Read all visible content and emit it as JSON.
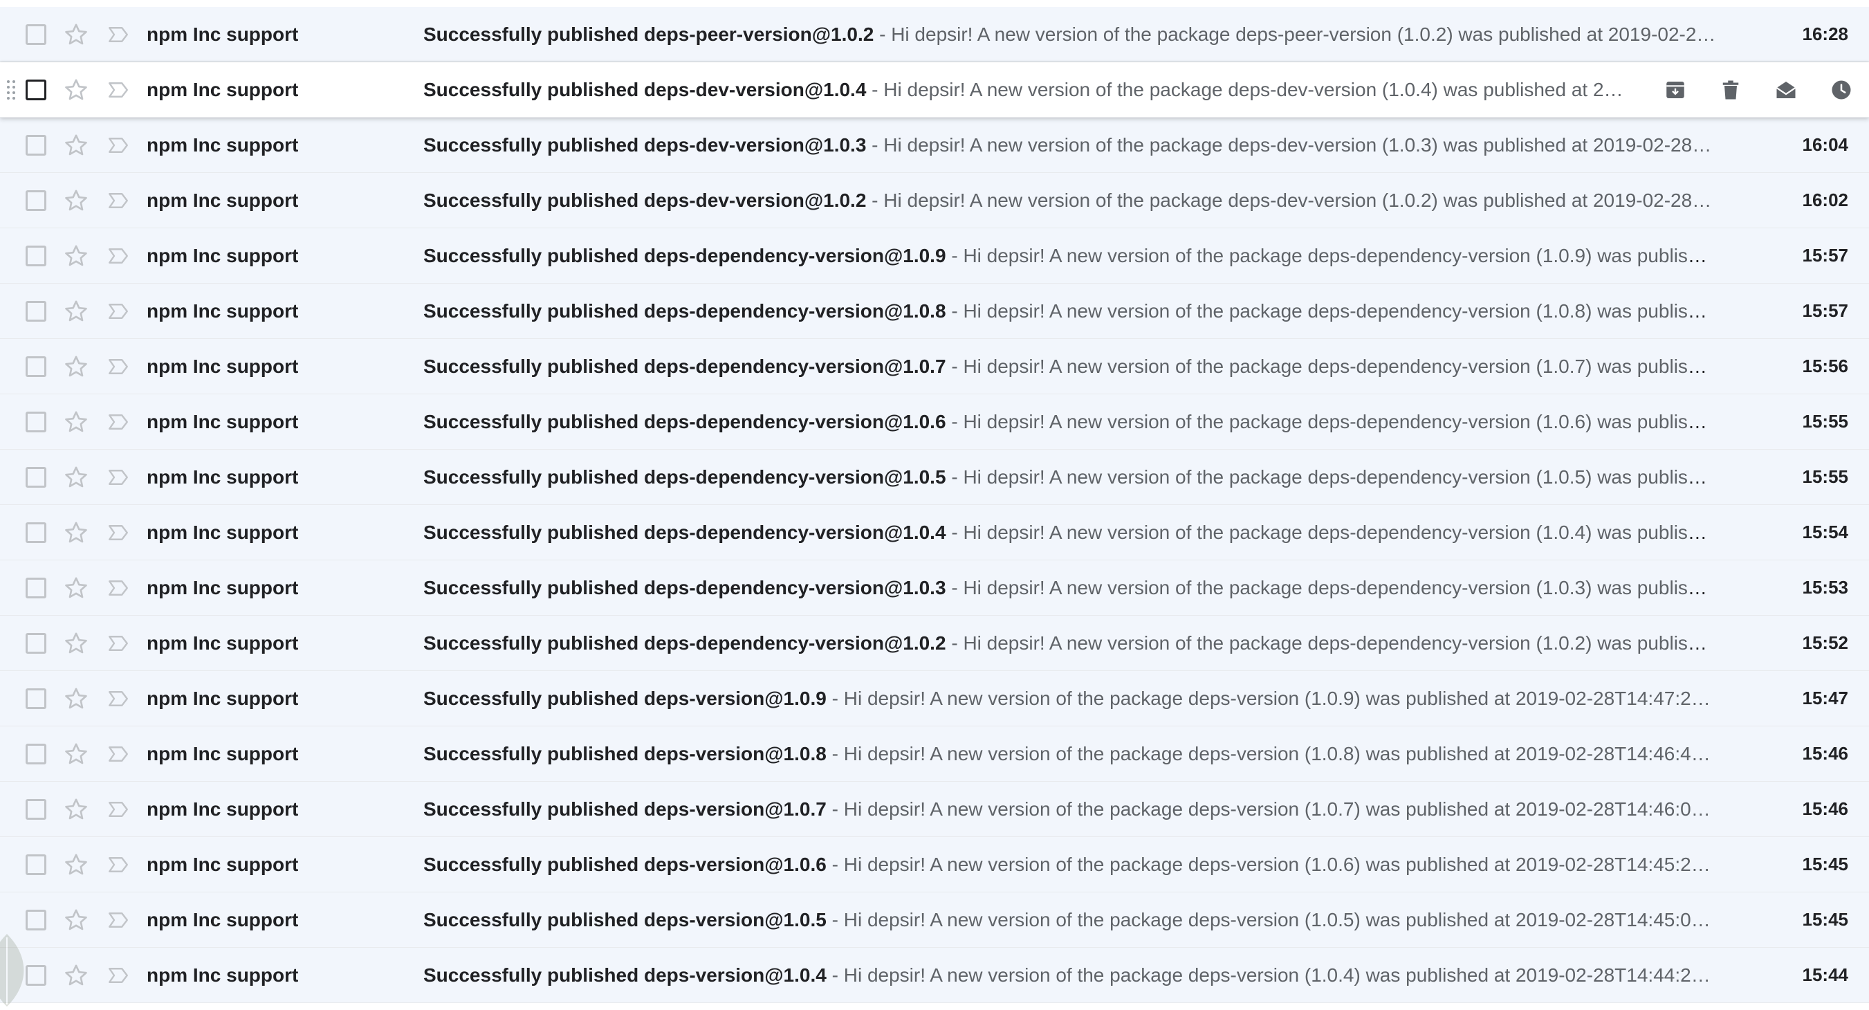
{
  "colors": {
    "row_read_bg": "#f2f6fc",
    "row_hover_bg": "#ffffff",
    "text_primary": "#202124",
    "text_secondary": "#5f6368",
    "icon_muted": "#c1c4c8",
    "icon_dark": "#5f6368"
  },
  "hover_actions": [
    {
      "name": "archive-icon"
    },
    {
      "name": "delete-icon"
    },
    {
      "name": "mark-as-unread-icon"
    },
    {
      "name": "snooze-icon"
    }
  ],
  "emails": [
    {
      "sender": "npm Inc support",
      "subject": "Successfully published deps-peer-version@1.0.2",
      "snippet": "Hi depsir! A new version of the package deps-peer-version (1.0.2) was published at 2019-02-2…",
      "time": "16:28"
    },
    {
      "sender": "npm Inc support",
      "subject": "Successfully published deps-dev-version@1.0.4",
      "snippet": "Hi depsir! A new version of the package deps-dev-version (1.0.4) was published at 2…",
      "time": "",
      "hover": true
    },
    {
      "sender": "npm Inc support",
      "subject": "Successfully published deps-dev-version@1.0.3",
      "snippet": "Hi depsir! A new version of the package deps-dev-version (1.0.3) was published at 2019-02-28…",
      "time": "16:04"
    },
    {
      "sender": "npm Inc support",
      "subject": "Successfully published deps-dev-version@1.0.2",
      "snippet": "Hi depsir! A new version of the package deps-dev-version (1.0.2) was published at 2019-02-28…",
      "time": "16:02"
    },
    {
      "sender": "npm Inc support",
      "subject": "Successfully published deps-dependency-version@1.0.9",
      "snippet": "Hi depsir! A new version of the package deps-dependency-version (1.0.9) was publish…",
      "time": "15:57"
    },
    {
      "sender": "npm Inc support",
      "subject": "Successfully published deps-dependency-version@1.0.8",
      "snippet": "Hi depsir! A new version of the package deps-dependency-version (1.0.8) was publish…",
      "time": "15:57"
    },
    {
      "sender": "npm Inc support",
      "subject": "Successfully published deps-dependency-version@1.0.7",
      "snippet": "Hi depsir! A new version of the package deps-dependency-version (1.0.7) was publish…",
      "time": "15:56"
    },
    {
      "sender": "npm Inc support",
      "subject": "Successfully published deps-dependency-version@1.0.6",
      "snippet": "Hi depsir! A new version of the package deps-dependency-version (1.0.6) was publish…",
      "time": "15:55"
    },
    {
      "sender": "npm Inc support",
      "subject": "Successfully published deps-dependency-version@1.0.5",
      "snippet": "Hi depsir! A new version of the package deps-dependency-version (1.0.5) was publish…",
      "time": "15:55"
    },
    {
      "sender": "npm Inc support",
      "subject": "Successfully published deps-dependency-version@1.0.4",
      "snippet": "Hi depsir! A new version of the package deps-dependency-version (1.0.4) was publish…",
      "time": "15:54"
    },
    {
      "sender": "npm Inc support",
      "subject": "Successfully published deps-dependency-version@1.0.3",
      "snippet": "Hi depsir! A new version of the package deps-dependency-version (1.0.3) was publish…",
      "time": "15:53"
    },
    {
      "sender": "npm Inc support",
      "subject": "Successfully published deps-dependency-version@1.0.2",
      "snippet": "Hi depsir! A new version of the package deps-dependency-version (1.0.2) was publish…",
      "time": "15:52"
    },
    {
      "sender": "npm Inc support",
      "subject": "Successfully published deps-version@1.0.9",
      "snippet": "Hi depsir! A new version of the package deps-version (1.0.9) was published at 2019-02-28T14:47:2…",
      "time": "15:47"
    },
    {
      "sender": "npm Inc support",
      "subject": "Successfully published deps-version@1.0.8",
      "snippet": "Hi depsir! A new version of the package deps-version (1.0.8) was published at 2019-02-28T14:46:4…",
      "time": "15:46"
    },
    {
      "sender": "npm Inc support",
      "subject": "Successfully published deps-version@1.0.7",
      "snippet": "Hi depsir! A new version of the package deps-version (1.0.7) was published at 2019-02-28T14:46:0…",
      "time": "15:46"
    },
    {
      "sender": "npm Inc support",
      "subject": "Successfully published deps-version@1.0.6",
      "snippet": "Hi depsir! A new version of the package deps-version (1.0.6) was published at 2019-02-28T14:45:2…",
      "time": "15:45"
    },
    {
      "sender": "npm Inc support",
      "subject": "Successfully published deps-version@1.0.5",
      "snippet": "Hi depsir! A new version of the package deps-version (1.0.5) was published at 2019-02-28T14:45:0…",
      "time": "15:45"
    },
    {
      "sender": "npm Inc support",
      "subject": "Successfully published deps-version@1.0.4",
      "snippet": "Hi depsir! A new version of the package deps-version (1.0.4) was published at 2019-02-28T14:44:2…",
      "time": "15:44"
    }
  ],
  "separator": " - "
}
